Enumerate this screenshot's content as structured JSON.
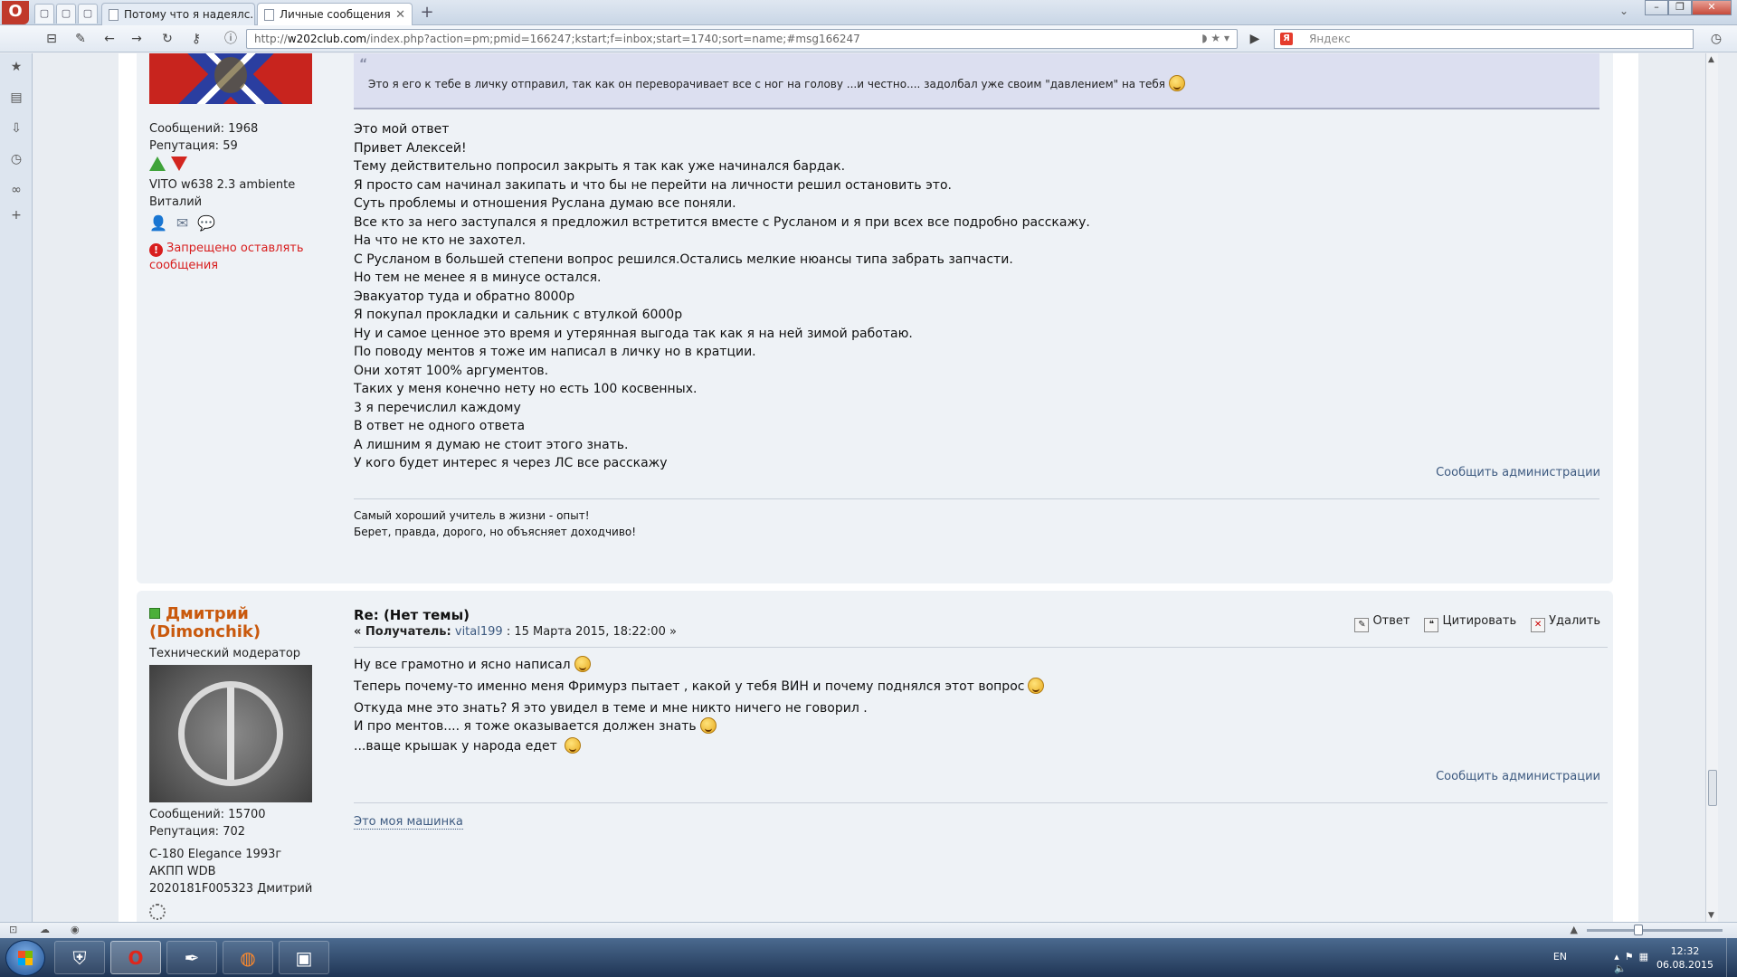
{
  "browser": {
    "tabs": [
      {
        "label": "Потому что я надеялс..."
      },
      {
        "label": "Личные сообщения"
      }
    ],
    "url_prefix": "http://",
    "url_host": "w202club.com",
    "url_rest": "/index.php?action=pm;pmid=166247;kstart;f=inbox;start=1740;sort=name;#msg166247",
    "search_placeholder": "Яндекс",
    "opera_label": "O",
    "new_tab": "+"
  },
  "post1": {
    "posts_count": "Сообщений: 1968",
    "reputation": "Репутация: 59",
    "car": "VITO w638 2.3 ambiente",
    "name": "Виталий",
    "forbidden": "Запрещено оставлять сообщения",
    "quote": "Это я его к тебе в личку отправил, так как он переворачивает все с ног на голову ...и честно.... задолбал уже своим \"давлением\" на тебя",
    "lines": [
      "Это мой ответ",
      "Привет Алексей!",
      "Тему действительно попросил закрыть я так как уже начинался бардак.",
      "Я просто сам начинал закипать и что бы не перейти на личности решил остановить это.",
      "Суть проблемы и отношения Руслана думаю все поняли.",
      "Все кто за него заступался я предложил встретится вместе с Русланом и я при всех все подробно расскажу.",
      "На что не кто не захотел.",
      "С Русланом в большей степени вопрос решился.Остались мелкие нюансы типа забрать запчасти.",
      "Но тем не менее я в минусе остался.",
      "Эвакуатор туда и обратно 8000р",
      "Я покупал прокладки и сальник с втулкой 6000р",
      "Ну и самое ценное это время и утерянная выгода так как я на ней зимой работаю.",
      "По поводу ментов я тоже им написал в личку но в кратции.",
      "Они хотят 100% аргументов.",
      "Таких у меня конечно нету но есть 100 косвенных.",
      "3 я перечислил каждому",
      "В ответ не одного ответа",
      "А лишним я думаю не стоит этого знать.",
      "У кого будет интерес я через ЛС все расскажу"
    ],
    "report": "Сообщить администрации",
    "signature": [
      "Самый хороший учитель в жизни - опыт!",
      "Берет, правда, дорого, но объясняет доходчиво!"
    ]
  },
  "post2": {
    "name_line1": "Дмитрий",
    "name_line2": "(Dimonchik)",
    "role": "Технический модератор",
    "posts_count": "Сообщений: 15700",
    "reputation": "Репутация: 702",
    "car1": "C-180 Elegance 1993г",
    "car2": "АКПП WDB",
    "car3": "2020181F005323 Дмитрий",
    "title": "Re: (Нет темы)",
    "meta_prefix": "« Получатель:",
    "recipient": "vital199",
    "meta_date": ": 15 Марта 2015, 18:22:00 »",
    "actions": {
      "reply": "Ответ",
      "quote": "Цитировать",
      "delete": "Удалить"
    },
    "lines": [
      "Ну все грамотно и ясно написал",
      "Теперь почему-то именно меня Фримурз пытает , какой у тебя ВИН и почему поднялся этот вопрос",
      "Откуда мне это знать? Я это увидел в теме и мне никто ничего не говорил .",
      "И про ментов.... я тоже оказывается должен знать",
      "...ваще крышак у народа едет"
    ],
    "report": "Сообщить администрации",
    "signature_link": "Это моя машинка"
  },
  "taskbar": {
    "lang": "EN",
    "time": "12:32",
    "date": "06.08.2015"
  },
  "colors": {
    "accent_name": "#c9590d",
    "link": "#3d5a80",
    "error": "#d81e1e"
  }
}
